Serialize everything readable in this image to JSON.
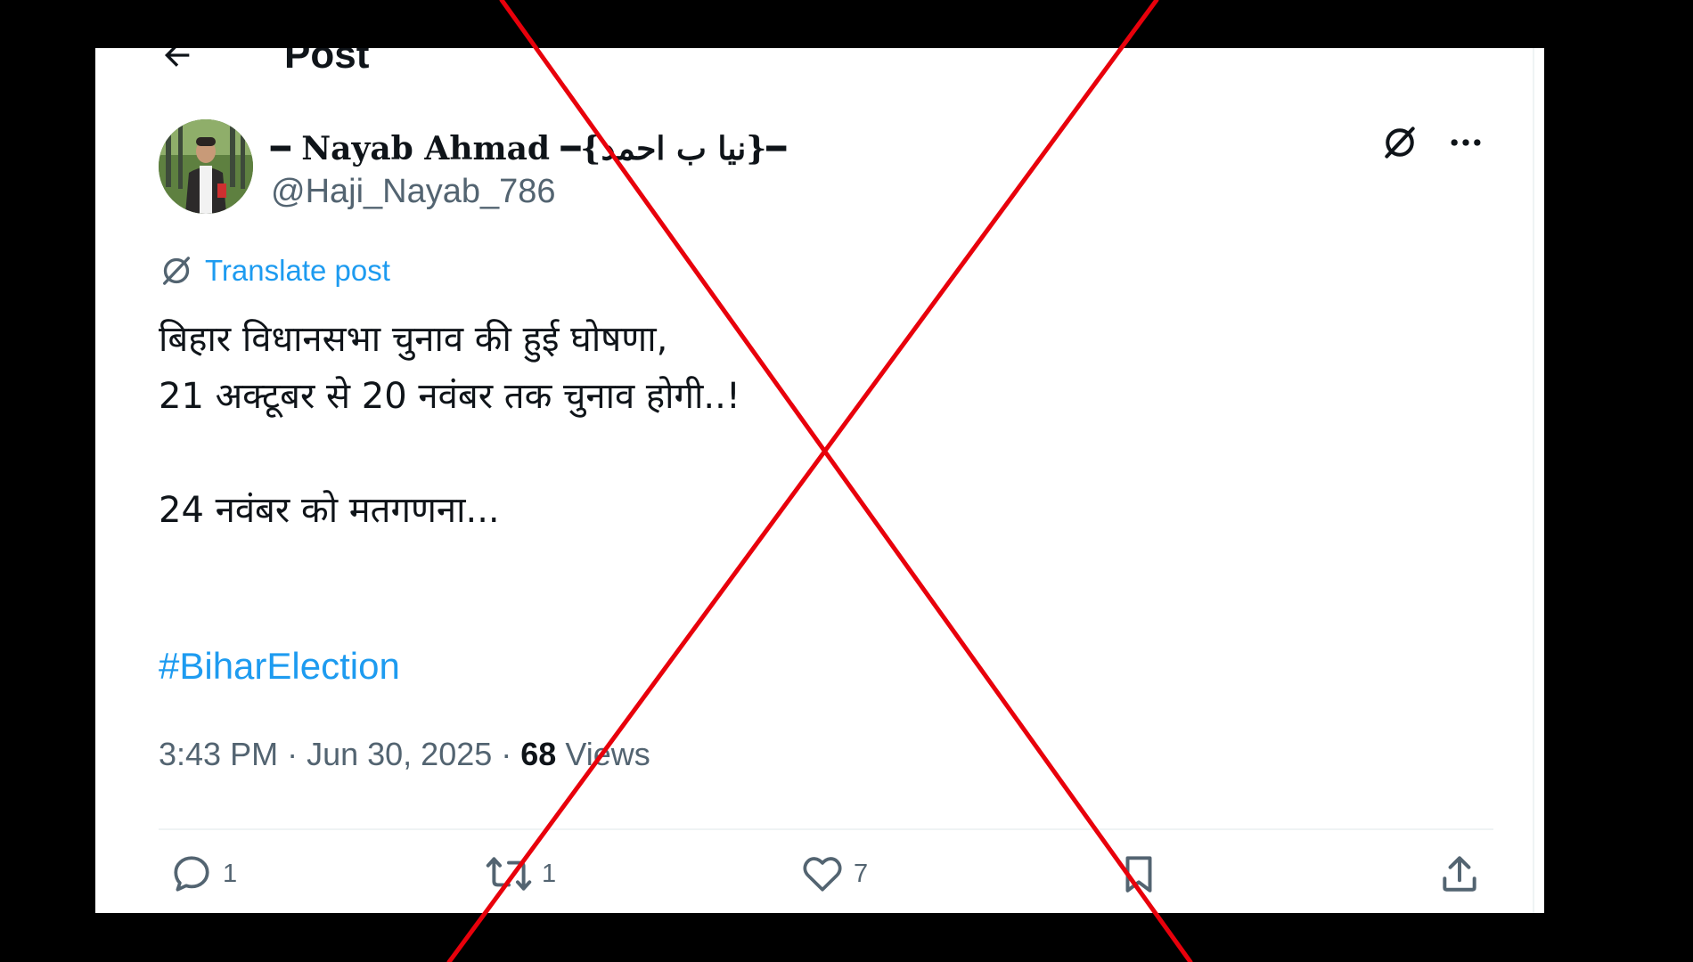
{
  "header": {
    "title": "Post"
  },
  "author": {
    "display_name": "━ Nayab Ahmad ━{نیا ب احمد}━",
    "handle": "@Haji_Nayab_786"
  },
  "translate": {
    "label": "Translate post"
  },
  "post": {
    "lines": [
      "बिहार विधानसभा चुनाव की हुई घोषणा,",
      "21 अक्टूबर से 20 नवंबर तक चुनाव होगी..!",
      "24 नवंबर को मतगणना...",
      "#BiharElection"
    ]
  },
  "meta": {
    "time": "3:43 PM",
    "date": "Jun 30, 2025",
    "separator": " · ",
    "views_count": "68",
    "views_label": "Views"
  },
  "actions": {
    "reply_count": "1",
    "repost_count": "1",
    "like_count": "7"
  },
  "icons": {
    "back": "back-arrow-icon",
    "grok": "grok-icon",
    "more": "more-icon",
    "translate": "translate-icon",
    "reply": "reply-icon",
    "repost": "repost-icon",
    "like": "like-icon",
    "bookmark": "bookmark-icon",
    "share": "share-icon"
  },
  "colors": {
    "text": "#0f1419",
    "secondary": "#536471",
    "accent": "#1d9bf0",
    "overlay_cross": "#e8000b",
    "background": "#000000"
  }
}
